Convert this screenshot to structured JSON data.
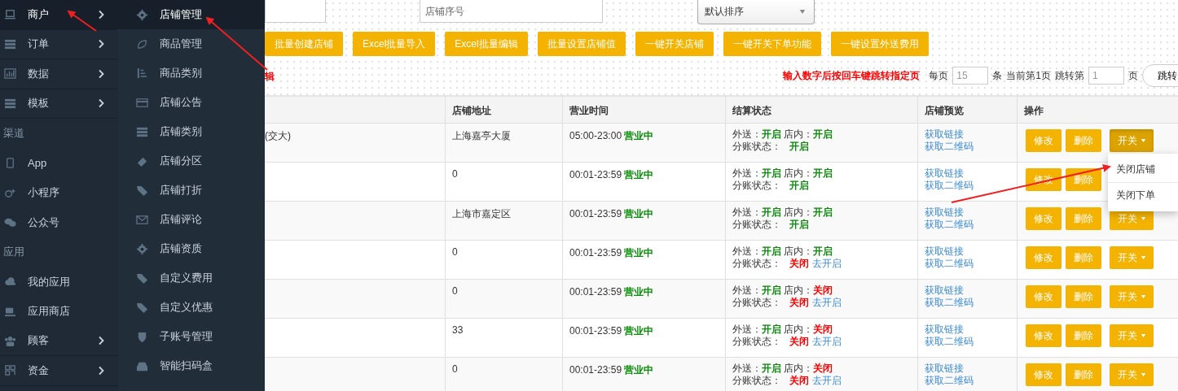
{
  "sidebar": {
    "items": [
      {
        "kind": "item",
        "label": "商户",
        "expandable": true,
        "selected": true
      },
      {
        "kind": "item",
        "label": "订单",
        "expandable": true,
        "selected": false
      },
      {
        "kind": "item",
        "label": "数据",
        "expandable": true,
        "selected": false
      },
      {
        "kind": "item",
        "label": "模板",
        "expandable": true,
        "selected": false
      },
      {
        "kind": "header",
        "label": "渠道"
      },
      {
        "kind": "item",
        "label": "App",
        "expandable": false,
        "selected": false
      },
      {
        "kind": "item",
        "label": "小程序",
        "expandable": false,
        "selected": false
      },
      {
        "kind": "item",
        "label": "公众号",
        "expandable": false,
        "selected": false
      },
      {
        "kind": "header",
        "label": "应用"
      },
      {
        "kind": "item",
        "label": "我的应用",
        "expandable": false,
        "selected": false
      },
      {
        "kind": "item",
        "label": "应用商店",
        "expandable": false,
        "selected": false
      },
      {
        "kind": "item",
        "label": "顾客",
        "expandable": true,
        "selected": false
      },
      {
        "kind": "item",
        "label": "资金",
        "expandable": true,
        "selected": false
      }
    ]
  },
  "submenu": {
    "items": [
      {
        "label": "店铺管理",
        "selected": true
      },
      {
        "label": "商品管理",
        "selected": false
      },
      {
        "label": "商品类别",
        "selected": false
      },
      {
        "label": "店铺公告",
        "selected": false
      },
      {
        "label": "店铺类别",
        "selected": false
      },
      {
        "label": "店铺分区",
        "selected": false
      },
      {
        "label": "店铺打折",
        "selected": false
      },
      {
        "label": "店铺评论",
        "selected": false
      },
      {
        "label": "店铺资质",
        "selected": false
      },
      {
        "label": "自定义费用",
        "selected": false
      },
      {
        "label": "自定义优惠",
        "selected": false
      },
      {
        "label": "子账号管理",
        "selected": false
      },
      {
        "label": "智能扫码盒",
        "selected": false
      }
    ]
  },
  "filters": {
    "serial_placeholder": "店铺序号",
    "sort_value": "默认排序"
  },
  "toolbar": [
    "批量创建店铺",
    "Excel批量导入",
    "Excel批量编辑",
    "批量设置店铺值",
    "一键开关店铺",
    "一键开关下单功能",
    "一键设置外送费用"
  ],
  "hint_fragment": "辑",
  "pagination": {
    "hint": "输入数字后按回车键跳转指定页",
    "per_page_label": "每页",
    "per_page": "15",
    "unit": "条",
    "current": "当前第1页",
    "jump_label": "跳转第",
    "jump_page": "1",
    "page_unit": "页",
    "jump_button": "跳转"
  },
  "table": {
    "columns": [
      "店铺地址",
      "营业时间",
      "结算状态",
      "店铺预览",
      "操作"
    ],
    "rows": [
      {
        "name": "(交大)",
        "address": "上海嘉亭大厦",
        "hours": "05:00-23:00",
        "status": "营业中",
        "delivery_label": "外送：",
        "delivery": {
          "text": "开启",
          "on": true
        },
        "dinein_label": "店内：",
        "dinein": {
          "text": "开启",
          "on": true
        },
        "split_label": "分账状态：",
        "split": {
          "text": "开启",
          "on": true
        },
        "links": [
          "获取链接",
          "获取二维码"
        ],
        "actions": [
          {
            "kind": "edit",
            "label": "修改"
          },
          {
            "kind": "delete",
            "label": "删除"
          },
          {
            "kind": "toggle",
            "label": "开关",
            "selected": true
          }
        ]
      },
      {
        "address": "0",
        "hours": "00:01-23:59",
        "status": "营业中",
        "delivery_label": "外送：",
        "delivery": {
          "text": "开启",
          "on": true
        },
        "dinein_label": "店内：",
        "dinein": {
          "text": "开启",
          "on": true
        },
        "split_label": "分账状态：",
        "split": {
          "text": "开启",
          "on": true
        },
        "links": [
          "获取链接",
          "获取二维码"
        ],
        "actions": [
          {
            "kind": "edit",
            "label": "修改"
          },
          {
            "kind": "delete",
            "label": "删除"
          }
        ]
      },
      {
        "address": "上海市嘉定区",
        "hours": "00:01-23:59",
        "status": "营业中",
        "delivery_label": "外送：",
        "delivery": {
          "text": "开启",
          "on": true
        },
        "dinein_label": "店内：",
        "dinein": {
          "text": "开启",
          "on": true
        },
        "split_label": "分账状态：",
        "split": {
          "text": "开启",
          "on": true
        },
        "links": [
          "获取链接",
          "获取二维码"
        ],
        "actions": [
          {
            "kind": "edit",
            "label": "修改"
          },
          {
            "kind": "delete",
            "label": "删除"
          },
          {
            "kind": "toggle",
            "label": "开关",
            "selected": false
          }
        ]
      },
      {
        "address": "0",
        "hours": "00:01-23:59",
        "status": "营业中",
        "delivery_label": "外送：",
        "delivery": {
          "text": "开启",
          "on": true
        },
        "dinein_label": "店内：",
        "dinein": {
          "text": "开启",
          "on": true
        },
        "split_label": "分账状态：",
        "split": {
          "text": "关闭",
          "on": false
        },
        "split_link": "去开启",
        "links": [
          "获取链接",
          "获取二维码"
        ],
        "actions": [
          {
            "kind": "edit",
            "label": "修改"
          },
          {
            "kind": "delete",
            "label": "删除"
          },
          {
            "kind": "toggle",
            "label": "开关",
            "selected": false
          }
        ]
      },
      {
        "address": "0",
        "hours": "00:01-23:59",
        "status": "营业中",
        "delivery_label": "外送：",
        "delivery": {
          "text": "开启",
          "on": true
        },
        "dinein_label": "店内：",
        "dinein": {
          "text": "关闭",
          "on": false
        },
        "split_label": "分账状态：",
        "split": {
          "text": "关闭",
          "on": false
        },
        "split_link": "去开启",
        "links": [
          "获取链接",
          "获取二维码"
        ],
        "actions": [
          {
            "kind": "edit",
            "label": "修改"
          },
          {
            "kind": "delete",
            "label": "删除"
          },
          {
            "kind": "toggle",
            "label": "开关",
            "selected": false
          }
        ]
      },
      {
        "address": "33",
        "hours": "00:01-23:59",
        "status": "营业中",
        "delivery_label": "外送：",
        "delivery": {
          "text": "开启",
          "on": true
        },
        "dinein_label": "店内：",
        "dinein": {
          "text": "关闭",
          "on": false
        },
        "split_label": "分账状态：",
        "split": {
          "text": "关闭",
          "on": false
        },
        "split_link": "去开启",
        "links": [
          "获取链接",
          "获取二维码"
        ],
        "actions": [
          {
            "kind": "edit",
            "label": "修改"
          },
          {
            "kind": "delete",
            "label": "删除"
          },
          {
            "kind": "toggle",
            "label": "开关",
            "selected": false
          }
        ]
      },
      {
        "address": "0",
        "hours": "00:01-23:59",
        "status": "营业中",
        "delivery_label": "外送：",
        "delivery": {
          "text": "开启",
          "on": true
        },
        "dinein_label": "店内：",
        "dinein": {
          "text": "关闭",
          "on": false
        },
        "split_label": "分账状态：",
        "split": {
          "text": "关闭",
          "on": false
        },
        "split_link": "去开启",
        "links": [
          "获取链接",
          "获取二维码"
        ],
        "actions": [
          {
            "kind": "edit",
            "label": "修改"
          },
          {
            "kind": "delete",
            "label": "删除"
          },
          {
            "kind": "toggle",
            "label": "开关",
            "selected": false
          }
        ]
      }
    ]
  },
  "dropdown": {
    "items": [
      "关闭店铺",
      "关闭下单"
    ]
  }
}
